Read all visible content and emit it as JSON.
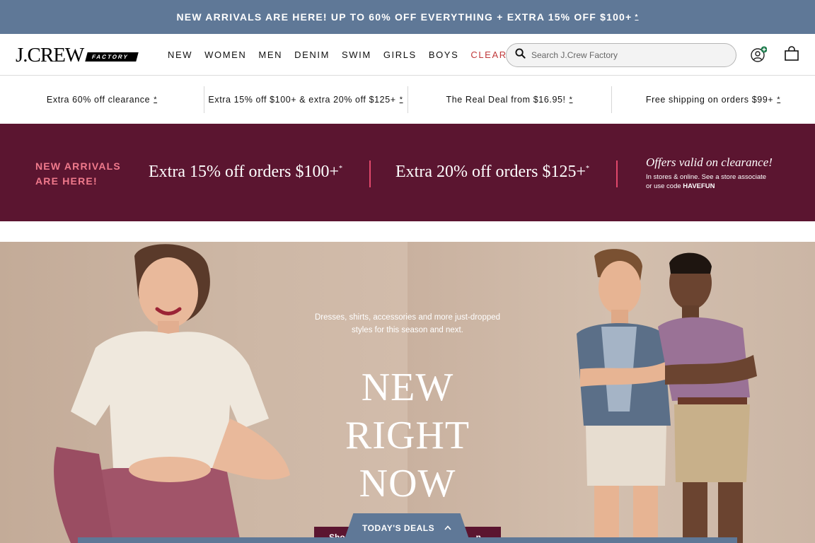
{
  "promo_bar": {
    "text": "NEW ARRIVALS ARE HERE! UP TO 60% OFF EVERYTHING + EXTRA 15% OFF $100+",
    "mark": "*"
  },
  "header": {
    "logo_word": "J.CREW",
    "logo_tag": "FACTORY",
    "nav": [
      "NEW",
      "WOMEN",
      "MEN",
      "DENIM",
      "SWIM",
      "GIRLS",
      "BOYS",
      "CLEARANCE"
    ],
    "search_placeholder": "Search J.Crew Factory",
    "icons": {
      "search": "search-icon",
      "account": "user-icon",
      "bag": "shopping-bag-icon"
    },
    "colors": {
      "clearance": "#c0393b"
    }
  },
  "offers": [
    {
      "text": "Extra 60% off clearance",
      "mark": "*"
    },
    {
      "text": "Extra 15% off $100+ & extra 20% off $125+",
      "mark": "*"
    },
    {
      "text": "The Real Deal from $16.95!",
      "mark": "*"
    },
    {
      "text": "Free shipping on orders $99+",
      "mark": "*"
    }
  ],
  "banner": {
    "lead_line1": "NEW ARRIVALS",
    "lead_line2": "ARE HERE!",
    "offer1": "Extra 15% off orders $100+",
    "offer2": "Extra 20% off orders $125+",
    "mark": "*",
    "valid_heading": "Offers valid on clearance!",
    "valid_line1": "In stores & online. See a store associate",
    "valid_line2_prefix": "or use code",
    "code": "HAVEFUN",
    "colors": {
      "background": "#5b1530",
      "accent": "#f07a8c"
    }
  },
  "hero": {
    "copy_line1": "Dresses, shirts, accessories and more just-dropped",
    "copy_line2": "styles for this season and next.",
    "title_line1": "NEW",
    "title_line2": "RIGHT",
    "title_line3": "NOW",
    "shop_left": "Sho",
    "shop_right": "n"
  },
  "deals": {
    "label": "TODAY'S DEALS",
    "chevron": "chevron-up-icon",
    "color": "#5f7897"
  }
}
